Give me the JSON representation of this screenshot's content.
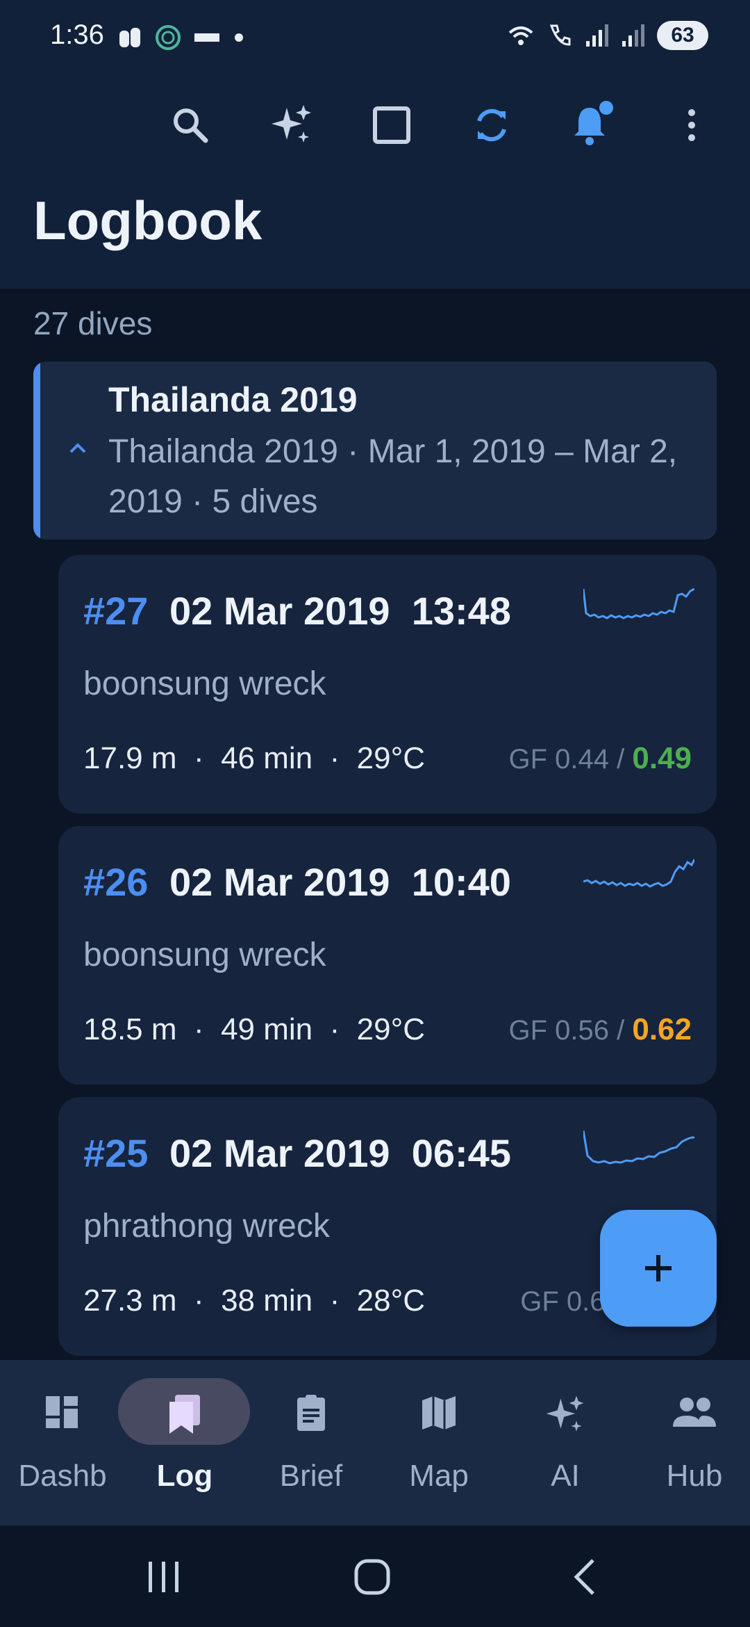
{
  "status_bar": {
    "time": "1:36",
    "battery": "63"
  },
  "header": {
    "title": "Logbook"
  },
  "dive_count": "27 dives",
  "trip": {
    "name": "Thailanda 2019",
    "details": "Thailanda 2019  ·  Mar 1, 2019 – Mar 2, 2019  ·  5 dives"
  },
  "dives": [
    {
      "number": "#27",
      "datetime": "02 Mar 2019  13:48",
      "site": "boonsung wreck",
      "stats": "17.9 m  ·  46 min  ·  29°C",
      "gf_low": "GF 0.44 / ",
      "gf_high": "0.49",
      "gf_high_color": "#4caf50"
    },
    {
      "number": "#26",
      "datetime": "02 Mar 2019  10:40",
      "site": "boonsung wreck",
      "stats": "18.5 m  ·  49 min  ·  29°C",
      "gf_low": "GF 0.56 / ",
      "gf_high": "0.62",
      "gf_high_color": "#f5a524"
    },
    {
      "number": "#25",
      "datetime": "02 Mar 2019  06:45",
      "site": "phrathong wreck",
      "stats": "27.3 m  ·  38 min  ·  28°C",
      "gf_low": "GF 0.67 /",
      "gf_high": "",
      "gf_high_color": "#6f8099"
    }
  ],
  "bottom_nav": [
    {
      "label": "Dashb",
      "icon": "dashboard-icon"
    },
    {
      "label": "Log",
      "icon": "logbook-icon",
      "active": true
    },
    {
      "label": "Brief",
      "icon": "clipboard-icon"
    },
    {
      "label": "Map",
      "icon": "map-icon"
    },
    {
      "label": "AI",
      "icon": "sparkle-icon"
    },
    {
      "label": "Hub",
      "icon": "people-icon"
    }
  ],
  "colors": {
    "accent": "#4d8ef0",
    "background": "#0b1526",
    "card": "#16243e",
    "header": "#12213a"
  }
}
